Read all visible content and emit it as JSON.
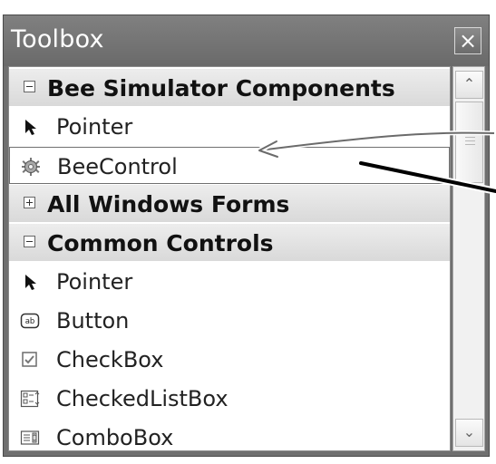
{
  "window": {
    "title": "Toolbox",
    "close_label": "×"
  },
  "groups": [
    {
      "label": "Bee Simulator Components",
      "expanded": true
    },
    {
      "label": "All Windows Forms",
      "expanded": false
    },
    {
      "label": "Common Controls",
      "expanded": true
    }
  ],
  "items": {
    "bee_pointer": {
      "label": "Pointer",
      "icon": "pointer-icon"
    },
    "bee_control": {
      "label": "BeeControl",
      "icon": "gear-icon"
    },
    "common_pointer": {
      "label": "Pointer",
      "icon": "pointer-icon"
    },
    "button": {
      "label": "Button",
      "icon": "button-icon"
    },
    "checkbox": {
      "label": "CheckBox",
      "icon": "checkbox-icon"
    },
    "checkedlistbox": {
      "label": "CheckedListBox",
      "icon": "checkedlistbox-icon"
    },
    "combobox": {
      "label": "ComboBox",
      "icon": "combobox-icon"
    }
  },
  "colors": {
    "titlebar": "#6f6f6f",
    "selection_border": "#707070",
    "annotation": "#000000"
  }
}
